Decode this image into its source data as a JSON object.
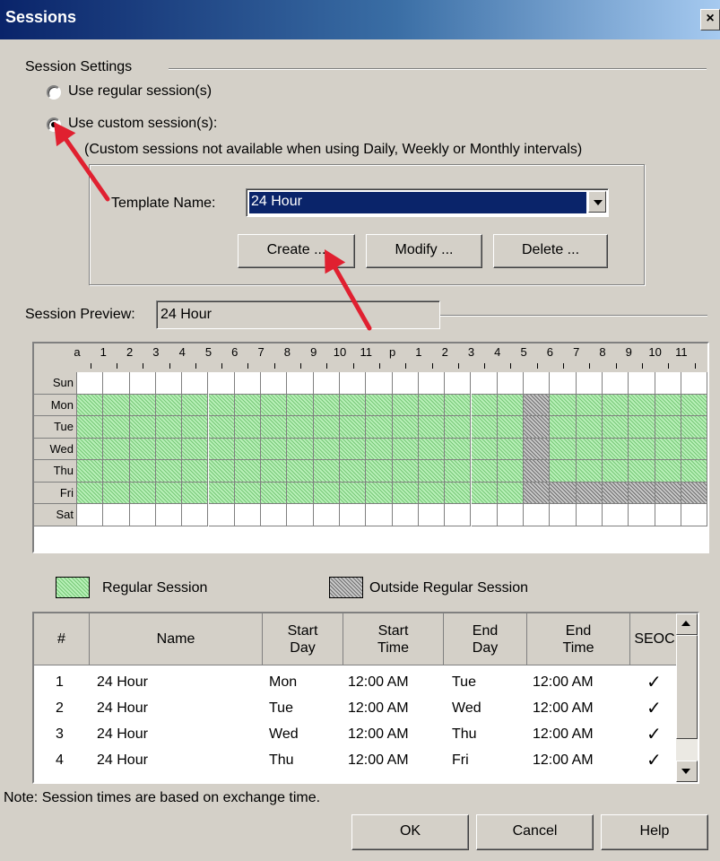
{
  "window": {
    "title": "Sessions",
    "close_glyph": "×"
  },
  "settings": {
    "group_label": "Session Settings",
    "radio_regular": "Use regular session(s)",
    "radio_custom": "Use custom session(s):",
    "custom_note": "(Custom sessions not available when using Daily, Weekly or Monthly intervals)",
    "selected": "custom",
    "template_label": "Template Name:",
    "template_value": "24 Hour",
    "create_label": "Create ...",
    "modify_label": "Modify ...",
    "delete_label": "Delete ..."
  },
  "preview": {
    "label": "Session Preview:",
    "value": "24 Hour",
    "hours": [
      "a",
      "1",
      "2",
      "3",
      "4",
      "5",
      "6",
      "7",
      "8",
      "9",
      "10",
      "11",
      "p",
      "1",
      "2",
      "3",
      "4",
      "5",
      "6",
      "7",
      "8",
      "9",
      "10",
      "11"
    ],
    "days": [
      "Sun",
      "Mon",
      "Tue",
      "Wed",
      "Thu",
      "Fri",
      "Sat"
    ],
    "colors": {
      "regular": "#b8f0b8",
      "outside": "#c0c0c0"
    }
  },
  "legend": {
    "regular_label": "Regular Session",
    "outside_label": "Outside Regular Session"
  },
  "table": {
    "columns": [
      "#",
      "Name",
      "Start\nDay",
      "Start\nTime",
      "End\nDay",
      "End\nTime",
      "SEOC"
    ],
    "rows": [
      [
        "1",
        "24 Hour",
        "Mon",
        "12:00 AM",
        "Tue",
        "12:00 AM",
        "✓"
      ],
      [
        "2",
        "24 Hour",
        "Tue",
        "12:00 AM",
        "Wed",
        "12:00 AM",
        "✓"
      ],
      [
        "3",
        "24 Hour",
        "Wed",
        "12:00 AM",
        "Thu",
        "12:00 AM",
        "✓"
      ],
      [
        "4",
        "24 Hour",
        "Thu",
        "12:00 AM",
        "Fri",
        "12:00 AM",
        "✓"
      ]
    ]
  },
  "footer": {
    "note": "Note: Session times are based on exchange time.",
    "ok_label": "OK",
    "cancel_label": "Cancel",
    "help_label": "Help"
  },
  "annotation_color": "#e02030"
}
